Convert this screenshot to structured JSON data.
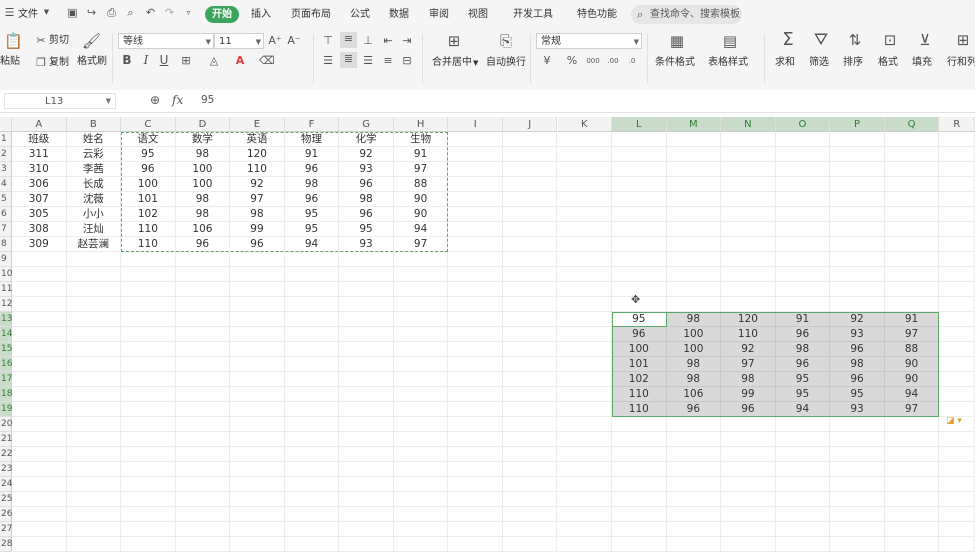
{
  "menu": {
    "file_label": "文件",
    "tabs": [
      "开始",
      "插入",
      "页面布局",
      "公式",
      "数据",
      "审阅",
      "视图",
      "开发工具",
      "特色功能"
    ],
    "search_placeholder": "查找命令、搜索模板"
  },
  "ribbon": {
    "paste": "粘贴",
    "cut": "剪切",
    "copy": "复制",
    "format_painter": "格式刷",
    "font_name": "等线",
    "font_size": "11",
    "merge_center": "合并居中",
    "auto_wrap": "自动换行",
    "number_format": "常规",
    "conditional_format": "条件格式",
    "table_style": "表格样式",
    "sum": "求和",
    "filter": "筛选",
    "sort": "排序",
    "format": "格式",
    "fill": "填充",
    "row_col": "行和列",
    "bold": "B",
    "italic": "I",
    "underline": "U",
    "font_color_letter": "A",
    "percent": "%",
    "currency": "¥",
    "thousands": "000",
    "decimal_inc": ".00",
    "decimal_dec": ".0"
  },
  "formula_bar": {
    "name_box": "L13",
    "fx": "fx",
    "value": "95"
  },
  "sheet": {
    "columns": [
      "A",
      "B",
      "C",
      "D",
      "E",
      "F",
      "G",
      "H",
      "I",
      "J",
      "K",
      "L",
      "M",
      "N",
      "O",
      "P",
      "Q",
      "R"
    ],
    "row_numbers": [
      "1",
      "2",
      "3",
      "4",
      "5",
      "6",
      "7",
      "8",
      "9",
      "10",
      "11",
      "12",
      "13",
      "14",
      "15",
      "16",
      "17",
      "18",
      "19",
      "20",
      "21",
      "22",
      "23",
      "24",
      "25",
      "26",
      "27",
      "28"
    ],
    "header_row": [
      "班级",
      "姓名",
      "语文",
      "数学",
      "英语",
      "物理",
      "化学",
      "生物"
    ],
    "rows": [
      [
        "311",
        "云彩",
        "95",
        "98",
        "120",
        "91",
        "92",
        "91"
      ],
      [
        "310",
        "李茜",
        "96",
        "100",
        "110",
        "96",
        "93",
        "97"
      ],
      [
        "306",
        "长成",
        "100",
        "100",
        "92",
        "98",
        "96",
        "88"
      ],
      [
        "307",
        "沈薇",
        "101",
        "98",
        "97",
        "96",
        "98",
        "90"
      ],
      [
        "305",
        "小小",
        "102",
        "98",
        "98",
        "95",
        "96",
        "90"
      ],
      [
        "308",
        "汪灿",
        "110",
        "106",
        "99",
        "95",
        "95",
        "94"
      ],
      [
        "309",
        "赵芸澜",
        "110",
        "96",
        "96",
        "94",
        "93",
        "97"
      ]
    ],
    "pasted": [
      [
        "95",
        "98",
        "120",
        "91",
        "92",
        "91"
      ],
      [
        "96",
        "100",
        "110",
        "96",
        "93",
        "97"
      ],
      [
        "100",
        "100",
        "92",
        "98",
        "96",
        "88"
      ],
      [
        "101",
        "98",
        "97",
        "96",
        "98",
        "90"
      ],
      [
        "102",
        "98",
        "98",
        "95",
        "96",
        "90"
      ],
      [
        "110",
        "106",
        "99",
        "95",
        "95",
        "94"
      ],
      [
        "110",
        "96",
        "96",
        "94",
        "93",
        "97"
      ]
    ]
  },
  "colors": {
    "accent": "#3ca55c",
    "selection_border": "#5aa86a",
    "selection_fill": "#d9d9d9"
  }
}
